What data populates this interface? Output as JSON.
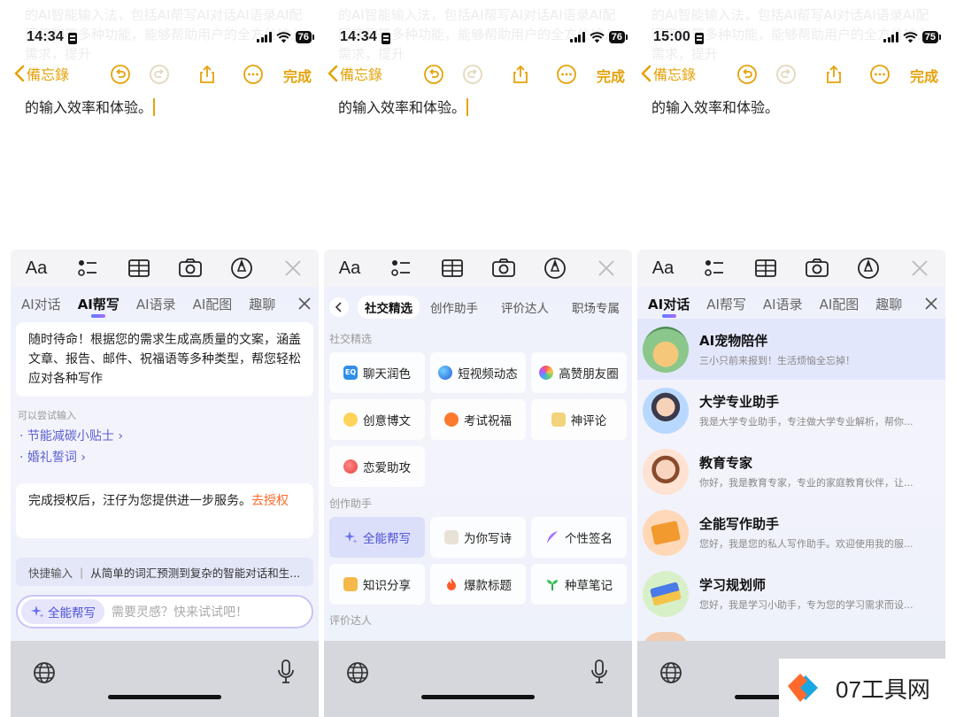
{
  "panels": [
    {
      "ghost_text": "的AI智能输入法，包括AI帮写AI对话AI语录AI配图趣聊等多种功能，能够帮助用户的全方位输入需求，提升",
      "status": {
        "time": "14:34",
        "battery": "76"
      },
      "nav": {
        "back_label": "備忘錄",
        "done_label": "完成"
      },
      "note_text": "的输入效率和体验。",
      "tabs": [
        "AI对话",
        "AI帮写",
        "AI语录",
        "AI配图",
        "趣聊"
      ],
      "active_tab": "AI帮写",
      "intro": "随时待命！根据您的需求生成高质量的文案，涵盖文章、报告、邮件、祝福语等多种类型，帮您轻松应对各种写作",
      "try_label": "可以尝试输入",
      "suggestions": [
        "· 节能减碳小贴士 ›",
        "· 婚礼誓词 ›"
      ],
      "auth_text": "完成授权后，汪仔为您提供进一步服务。",
      "auth_link": "去授权",
      "quick_label": "快捷输入",
      "quick_text": "从简单的词汇预测到复杂的智能对话和生...",
      "mode_button": "全能帮写",
      "input_placeholder": "需要灵感？快来试试吧！"
    },
    {
      "status": {
        "time": "14:34",
        "battery": "76"
      },
      "nav": {
        "back_label": "備忘錄",
        "done_label": "完成"
      },
      "note_text": "的输入效率和体验。",
      "cat_tabs": [
        "社交精选",
        "创作助手",
        "评价达人",
        "职场专属"
      ],
      "active_cat": "社交精选",
      "sections": [
        {
          "title": "社交精选",
          "items": [
            "聊天润色",
            "短视频动态",
            "高赞朋友圈",
            "创意博文",
            "考试祝福",
            "神评论",
            "恋爱助攻"
          ]
        },
        {
          "title": "创作助手",
          "items": [
            "全能帮写",
            "为你写诗",
            "个性签名",
            "知识分享",
            "爆款标题",
            "种草笔记"
          ]
        },
        {
          "title": "评价达人",
          "items": []
        }
      ]
    },
    {
      "status": {
        "time": "15:00",
        "battery": "75"
      },
      "nav": {
        "back_label": "備忘錄",
        "done_label": "完成"
      },
      "note_text": "的输入效率和体验。",
      "tabs": [
        "AI对话",
        "AI帮写",
        "AI语录",
        "AI配图",
        "趣聊"
      ],
      "active_tab": "AI对话",
      "assistants": [
        {
          "name": "AI宠物陪伴",
          "desc": "三小只前来报到！生活烦恼全忘掉！"
        },
        {
          "name": "大学专业助手",
          "desc": "我是大学专业助手，专注做大学专业解析，帮你..."
        },
        {
          "name": "教育专家",
          "desc": "你好，我是教育专家，专业的家庭教育伙伴，让..."
        },
        {
          "name": "全能写作助手",
          "desc": "您好，我是您的私人写作助手。欢迎使用我的服..."
        },
        {
          "name": "学习规划师",
          "desc": "您好，我是学习小助手，专为您的学习需求而设..."
        }
      ]
    }
  ],
  "watermark": {
    "text": "07工具网"
  },
  "colors": {
    "accent": "#e5a20a",
    "ai_blue": "#4a4fd6",
    "auth_link": "#ff6a2c"
  }
}
